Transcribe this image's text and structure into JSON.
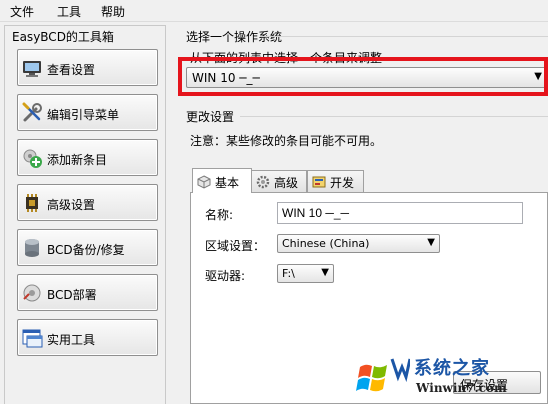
{
  "menu": {
    "file": "文件",
    "tools": "工具",
    "help": "帮助"
  },
  "toolbox": {
    "title": "EasyBCD的工具箱",
    "buttons": [
      {
        "label": "查看设置",
        "icon": "monitor-icon"
      },
      {
        "label": "编辑引导菜单",
        "icon": "wrench-screwdriver-icon"
      },
      {
        "label": "添加新条目",
        "icon": "add-entry-icon"
      },
      {
        "label": "高级设置",
        "icon": "chip-icon"
      },
      {
        "label": "BCD备份/修复",
        "icon": "database-icon"
      },
      {
        "label": "BCD部署",
        "icon": "deploy-icon"
      },
      {
        "label": "实用工具",
        "icon": "window-tools-icon"
      }
    ]
  },
  "os_select": {
    "title": "选择一个操作系统",
    "hint": "从下面的列表中选择一个条目来调整",
    "selected": "WIN 10 ─_─"
  },
  "change_settings": {
    "title": "更改设置",
    "note": "注意：某些修改的条目可能不可用。",
    "tabs": [
      {
        "label": "基本"
      },
      {
        "label": "高级"
      },
      {
        "label": "开发"
      }
    ],
    "fields": {
      "name_label": "名称:",
      "name_value": "WIN 10 ─_─",
      "locale_label": "区域设置：",
      "locale_value": "Chinese (China)",
      "drive_label": "驱动器:",
      "drive_value": "F:\\"
    },
    "save_label": "保存设置"
  },
  "watermark": {
    "title": "系统之家",
    "url": "Winwin7.com"
  },
  "colors": {
    "highlight": "#e5141c",
    "background": "#f0f0f0",
    "watermark_blue": "#1c56a6"
  }
}
